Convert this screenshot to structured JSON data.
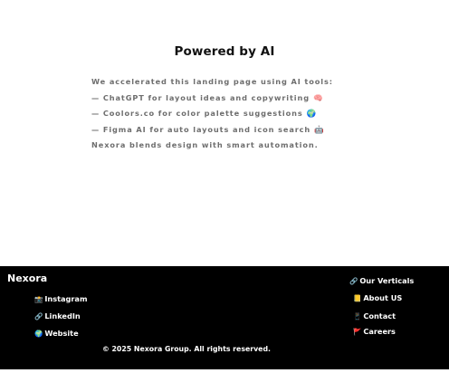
{
  "ai_section": {
    "title": "Powered by AI",
    "lines": [
      {
        "text": "We accelerated this landing page using AI tools:",
        "icon": ""
      },
      {
        "text": "— ChatGPT for layout ideas and copywriting",
        "icon": "🧠"
      },
      {
        "text": "— Coolors.co for color palette suggestions",
        "icon": "🌍"
      },
      {
        "text": "— Figma AI for auto layouts and icon search",
        "icon": "🤖"
      },
      {
        "text": "Nexora blends design with smart automation.",
        "icon": ""
      }
    ]
  },
  "footer": {
    "brand": "Nexora",
    "social": {
      "instagram": {
        "icon": "📸",
        "label": "Instagram"
      },
      "linkedin": {
        "icon": "🔗",
        "label": "LinkedIn"
      },
      "website": {
        "icon": "🌍",
        "label": "Website"
      }
    },
    "nav": {
      "verticals": {
        "icon": "🔗",
        "label": "Our Verticals"
      },
      "about": {
        "icon": "📒",
        "label": "About US"
      },
      "contact": {
        "icon": "📱",
        "label": "Contact"
      },
      "careers": {
        "icon": "🚩",
        "label": "Careers"
      }
    },
    "copyright": "© 2025 Nexora Group. All rights reserved."
  },
  "colors": {
    "background": "#ffffff",
    "footer_background": "#000000",
    "title_text": "#111111",
    "body_text": "#6e6e6e",
    "footer_text": "#ffffff"
  }
}
